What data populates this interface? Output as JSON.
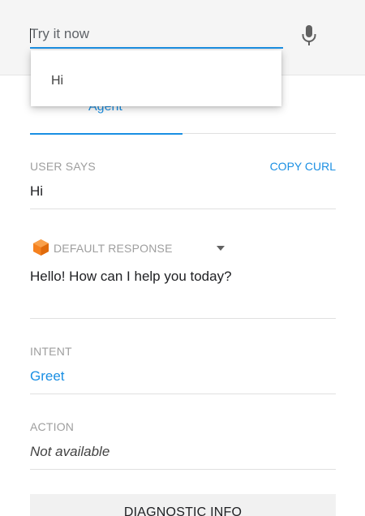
{
  "search": {
    "placeholder": "Try it now",
    "value": ""
  },
  "suggestion": {
    "item": "Hi"
  },
  "tabs": {
    "agent_label": "Agent"
  },
  "user_says": {
    "label": "USER SAYS",
    "copy_curl_label": "COPY CURL",
    "value": "Hi"
  },
  "response": {
    "label": "DEFAULT RESPONSE",
    "value": "Hello! How can I help you today?"
  },
  "intent": {
    "label": "INTENT",
    "value": "Greet"
  },
  "action": {
    "label": "ACTION",
    "value": "Not available"
  },
  "diagnostic": {
    "label": "DIAGNOSTIC INFO"
  },
  "icons": {
    "mic": "microphone-icon",
    "cube": "default-response-cube-icon",
    "dropdown": "caret-down-icon"
  },
  "colors": {
    "accent": "#1a8fe3",
    "cube_orange": "#f5811f",
    "label_gray": "#9e9e9e"
  }
}
